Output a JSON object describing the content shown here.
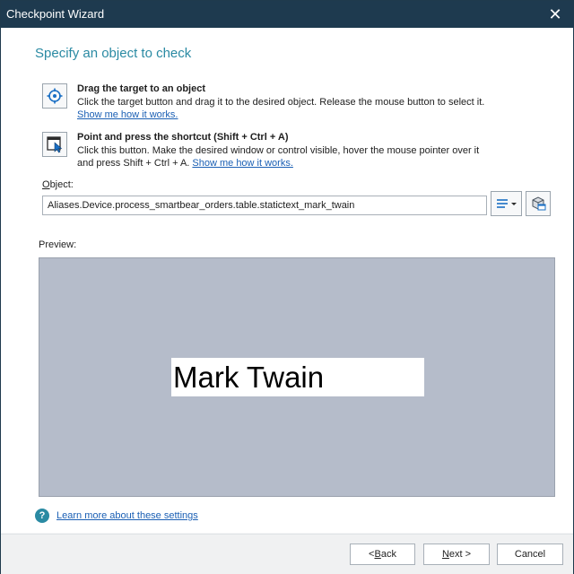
{
  "window": {
    "title": "Checkpoint Wizard",
    "close_label": "✕"
  },
  "heading": "Specify an object to check",
  "option_drag": {
    "title": "Drag the target to an object",
    "desc": "Click the target button and drag it to the desired object. Release the mouse button to select it.",
    "link": "Show me how it works."
  },
  "option_point": {
    "title": "Point and press the shortcut (Shift + Ctrl + A)",
    "desc1": "Click this button. Make the desired window or control visible, hover the mouse pointer over it",
    "desc2": "and press Shift + Ctrl + A.",
    "link": "Show me how it works."
  },
  "object": {
    "label_accel": "O",
    "label_rest": "bject:",
    "value": "Aliases.Device.process_smartbear_orders.table.statictext_mark_twain"
  },
  "preview": {
    "label": "Preview:",
    "text": "Mark Twain"
  },
  "help_link": "Learn more about these settings",
  "buttons": {
    "back_prefix": "< ",
    "back_accel": "B",
    "back_rest": "ack",
    "next_accel": "N",
    "next_rest": "ext >",
    "cancel": "Cancel"
  }
}
